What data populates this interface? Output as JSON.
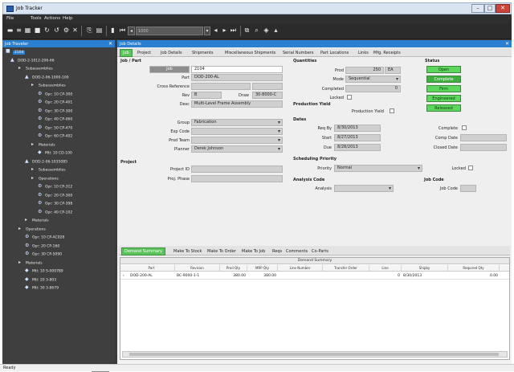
{
  "window": {
    "title": "Job Tracker"
  },
  "menu": [
    "File",
    "Tools",
    "Actions",
    "Help"
  ],
  "toolbar": {
    "search_value": "1000",
    "record_label": "Job"
  },
  "tree": {
    "header": "Job Traveler",
    "items": [
      {
        "label": "2104",
        "level": 0
      },
      {
        "label": "DOD-2-1012-206-66",
        "level": 1
      },
      {
        "label": "Subassemblies",
        "level": 2
      },
      {
        "label": "DOD-2-06-1000-100",
        "level": 3
      },
      {
        "label": "Subassemblies",
        "level": 4
      },
      {
        "label": "Opr: 10 CP-300",
        "level": 5
      },
      {
        "label": "Opr: 20 CP-401",
        "level": 5
      },
      {
        "label": "Opr: 30 CP-300",
        "level": 5
      },
      {
        "label": "Opr: 40 CP-060",
        "level": 5
      },
      {
        "label": "Opr: 50 CP-470",
        "level": 5
      },
      {
        "label": "Opr: 60 CP-402",
        "level": 5
      },
      {
        "label": "Materials",
        "level": 4
      },
      {
        "label": "Mtl: 10 CD-100",
        "level": 5
      },
      {
        "label": "DOD-2-06-1035085",
        "level": 3
      },
      {
        "label": "Subassemblies",
        "level": 4
      },
      {
        "label": "Operations",
        "level": 4
      },
      {
        "label": "Opr: 10 CP-312",
        "level": 5
      },
      {
        "label": "Opr: 20 CP-300",
        "level": 5
      },
      {
        "label": "Opr: 30 CP-398",
        "level": 5
      },
      {
        "label": "Opr: 40 CP-102",
        "level": 5
      },
      {
        "label": "Materials",
        "level": 3
      },
      {
        "label": "Operations",
        "level": 2
      },
      {
        "label": "Opr: 10 CP-AC028",
        "level": 3
      },
      {
        "label": "Opr: 20 CP-160",
        "level": 3
      },
      {
        "label": "Opr: 30 CP-5090",
        "level": 3
      },
      {
        "label": "Materials",
        "level": 2
      },
      {
        "label": "Mtl: 10 S-000789",
        "level": 3
      },
      {
        "label": "Mtl: 20 3-803",
        "level": 3
      },
      {
        "label": "Mtl: 30 3-8679",
        "level": 3
      }
    ]
  },
  "main": {
    "header": "Job Details",
    "tabs": [
      "Job",
      "Project",
      "Job Details",
      "Shipments",
      "Miscellaneous Shipments",
      "Serial Numbers",
      "Part Locations",
      "Links",
      "Mfg. Receipts"
    ],
    "job_part": {
      "section": "Job / Part",
      "job_button": "Job",
      "job_value": "2104",
      "part_label": "Part",
      "part_value": "DOD-200-AL",
      "cross_ref_label": "Cross Reference",
      "cross_ref_value": "",
      "rev_label": "Rev",
      "rev_value": "B",
      "draw_label": "Draw",
      "draw_value": "30-8000-C",
      "desc_label": "Desc",
      "desc_value": "Multi-Level Frame Assembly"
    },
    "group_fields": {
      "group_label": "Group",
      "group_value": "Fabrication",
      "exp_code_label": "Exp Code",
      "exp_code_value": "",
      "prod_team_label": "Prod Team",
      "prod_team_value": "",
      "planner_label": "Planner",
      "planner_value": "Derek Johnson"
    },
    "project": {
      "section": "Project",
      "project_id_label": "Project ID",
      "project_id_value": "",
      "proj_phase_label": "Proj. Phase",
      "proj_phase_value": ""
    },
    "quantities": {
      "section": "Quantities",
      "prod_label": "Prod",
      "prod_value": "250",
      "prod_unit": "EA",
      "mode_label": "Mode",
      "mode_value": "Sequential",
      "completed_label": "Completed",
      "completed_value": "0",
      "locked_label": "Locked",
      "production_yield_section": "Production Yield",
      "production_yield_label": "Production Yield"
    },
    "status": {
      "section": "Status",
      "buttons": [
        "Open",
        "Complete",
        "Firm",
        "Engineered",
        "Released"
      ]
    },
    "dates": {
      "section": "Dates",
      "req_by_label": "Req By",
      "req_by_value": "8/30/2013",
      "start_label": "Start",
      "start_value": "8/27/2013",
      "due_label": "Due",
      "due_value": "8/28/2013",
      "complete_label": "Complete",
      "comp_date_label": "Comp Date",
      "closed_date_label": "Closed Date"
    },
    "scheduling": {
      "section": "Scheduling Priority",
      "priority_label": "Priority",
      "priority_value": "Normal",
      "locked_label": "Locked"
    },
    "analysis": {
      "section": "Analysis Code",
      "analysis_label": "Analysis",
      "analysis_value": ""
    },
    "job_code": {
      "section": "Job Code",
      "label": "Job Code",
      "value": ""
    },
    "bottom_tabs": [
      "Demand Summary",
      "Make To Stock",
      "Make To Order",
      "Make To Job",
      "Reqs",
      "Comments",
      "Co-Parts"
    ],
    "grid": {
      "caption": "Demand Summary",
      "columns": [
        "Part",
        "Revision",
        "Prod Qty",
        "MRP Qty",
        "Line Number",
        "Transfer Order",
        "Line",
        "Shipby",
        "Required Qty"
      ],
      "rows": [
        [
          "DOD-200-AL",
          "BC-9000-1-1",
          "380.00",
          "380.00",
          "",
          "",
          "0",
          "8/30/2013",
          "0.00"
        ]
      ]
    }
  },
  "statusbar": {
    "text": "Ready"
  }
}
